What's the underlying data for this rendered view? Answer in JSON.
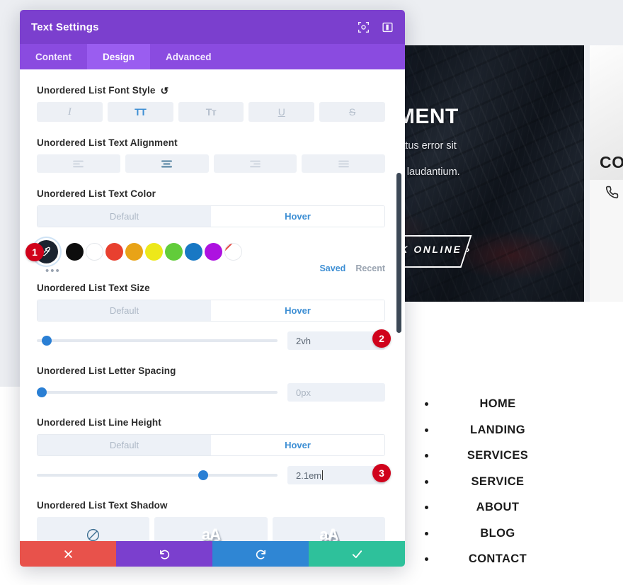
{
  "modal": {
    "title": "Text Settings",
    "header_icons": [
      {
        "name": "focus-icon"
      },
      {
        "name": "split-view-icon"
      }
    ],
    "tabs": [
      {
        "label": "Content",
        "active": false
      },
      {
        "label": "Design",
        "active": true
      },
      {
        "label": "Advanced",
        "active": false
      }
    ],
    "fields": {
      "font_style": {
        "label": "Unordered List Font Style",
        "reset_icon": "↺",
        "options": [
          {
            "name": "italic-button",
            "glyph": "I",
            "active": false
          },
          {
            "name": "uppercase-button",
            "glyph": "TT",
            "active": true
          },
          {
            "name": "small-caps-button",
            "glyph": "Tᴛ",
            "active": false
          },
          {
            "name": "underline-button",
            "glyph": "U",
            "active": false
          },
          {
            "name": "strikethrough-button",
            "glyph": "S",
            "active": false
          }
        ]
      },
      "text_alignment": {
        "label": "Unordered List Text Alignment",
        "options": [
          {
            "name": "align-left-button",
            "active": false
          },
          {
            "name": "align-center-button",
            "active": true
          },
          {
            "name": "align-right-button",
            "active": false
          },
          {
            "name": "align-justify-button",
            "active": false
          }
        ]
      },
      "text_color": {
        "label": "Unordered List Text Color",
        "default_label": "Default",
        "hover_label": "Hover",
        "active_state": "Hover",
        "swatches": [
          {
            "name": "eyedropper-swatch",
            "color": "#1b2430"
          },
          {
            "name": "swatch-black",
            "color": "#0d0d0d"
          },
          {
            "name": "swatch-white",
            "color": "#ffffff"
          },
          {
            "name": "swatch-red",
            "color": "#e8402f"
          },
          {
            "name": "swatch-orange",
            "color": "#e8a317"
          },
          {
            "name": "swatch-yellow",
            "color": "#ede81a"
          },
          {
            "name": "swatch-green",
            "color": "#62cc3a"
          },
          {
            "name": "swatch-blue",
            "color": "#1878c4"
          },
          {
            "name": "swatch-purple",
            "color": "#ad12e0"
          },
          {
            "name": "swatch-none",
            "color": "#ffffff"
          }
        ],
        "more_dots": "•••",
        "saved_label": "Saved",
        "recent_label": "Recent",
        "badge": "1"
      },
      "text_size": {
        "label": "Unordered List Text Size",
        "default_label": "Default",
        "hover_label": "Hover",
        "active_state": "Hover",
        "value": "2vh",
        "slider_percent": 4,
        "badge": "2"
      },
      "letter_spacing": {
        "label": "Unordered List Letter Spacing",
        "value": "",
        "placeholder": "0px",
        "slider_percent": 2
      },
      "line_height": {
        "label": "Unordered List Line Height",
        "default_label": "Default",
        "hover_label": "Hover",
        "active_state": "Hover",
        "value": "2.1em",
        "slider_percent": 69,
        "badge": "3"
      },
      "text_shadow": {
        "label": "Unordered List Text Shadow",
        "options": [
          {
            "name": "shadow-none-button",
            "glyph": ""
          },
          {
            "name": "shadow-soft-button",
            "glyph": "aA"
          },
          {
            "name": "shadow-hard-button",
            "glyph": "aA"
          }
        ]
      }
    },
    "footer_actions": [
      {
        "name": "close-button",
        "icon": "close-icon",
        "color": "#e8524b"
      },
      {
        "name": "undo-button",
        "icon": "undo-icon",
        "color": "#7b3fce"
      },
      {
        "name": "redo-button",
        "icon": "redo-icon",
        "color": "#2f86d4"
      },
      {
        "name": "save-button",
        "icon": "check-icon",
        "color": "#2ec19b"
      }
    ]
  },
  "page": {
    "hero": {
      "title": "APPOINTMENT",
      "line1": "atis unde omnis iste natus error sit",
      "line2": "cusantium doloremque laudantium.",
      "button": "BOOK ONLINE ›"
    },
    "contact_card": {
      "title": "CO",
      "phone_icon": "📞"
    },
    "nav_list": [
      "HOME",
      "LANDING",
      "SERVICES",
      "SERVICE",
      "ABOUT",
      "BLOG",
      "CONTACT"
    ]
  },
  "colors": {
    "header_purple": "#7b3fce",
    "tabbar_purple": "#8a4be0",
    "tab_active_purple": "#9a5df0",
    "accent_blue": "#3e8fd4",
    "badge_red": "#d0021b"
  }
}
